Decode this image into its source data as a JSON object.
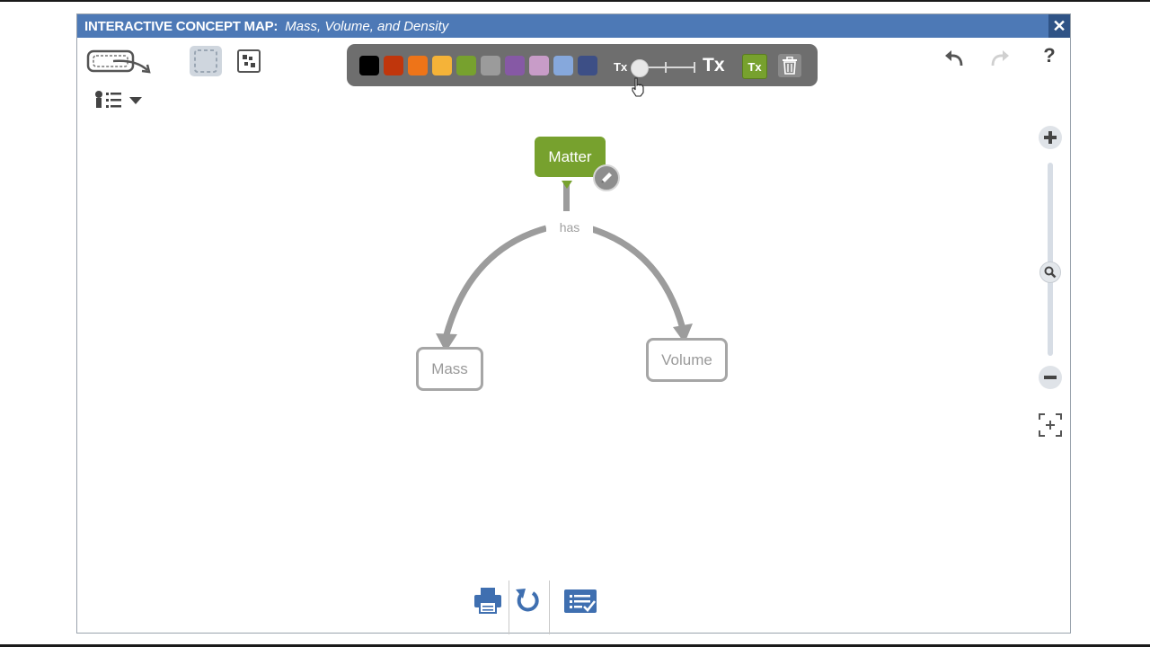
{
  "window": {
    "title": "INTERACTIVE CONCEPT MAP:",
    "subtitle": "Mass, Volume, and Density",
    "close_glyph": "✕"
  },
  "toolbar": {
    "icons": [
      "lasso-icon",
      "select-box-icon",
      "add-node-icon",
      "legend-list-icon",
      "dropdown-caret-icon",
      "undo-icon",
      "redo-icon",
      "help-icon"
    ],
    "help_label": "?"
  },
  "palette": {
    "swatches": [
      "#000000",
      "#c0360c",
      "#ee7418",
      "#f5b338",
      "#77a12e",
      "#9b9b9b",
      "#8659a5",
      "#c89cc8",
      "#86a8dc",
      "#3d4f86"
    ],
    "text_size_small": "Tx",
    "text_size_large": "Tx",
    "text_style_button": "Tx",
    "text_size_level": 0
  },
  "map": {
    "nodes": {
      "matter": "Matter",
      "mass": "Mass",
      "volume": "Volume"
    },
    "link_label": "has"
  },
  "zoom": {
    "level": 0.5
  },
  "colors": {
    "title_bar": "#4d79b6",
    "accent_green": "#77a12e",
    "icon_blue": "#3f6fb0"
  },
  "footer": {
    "icons": [
      "print-icon",
      "reset-icon",
      "checklist-icon"
    ]
  }
}
